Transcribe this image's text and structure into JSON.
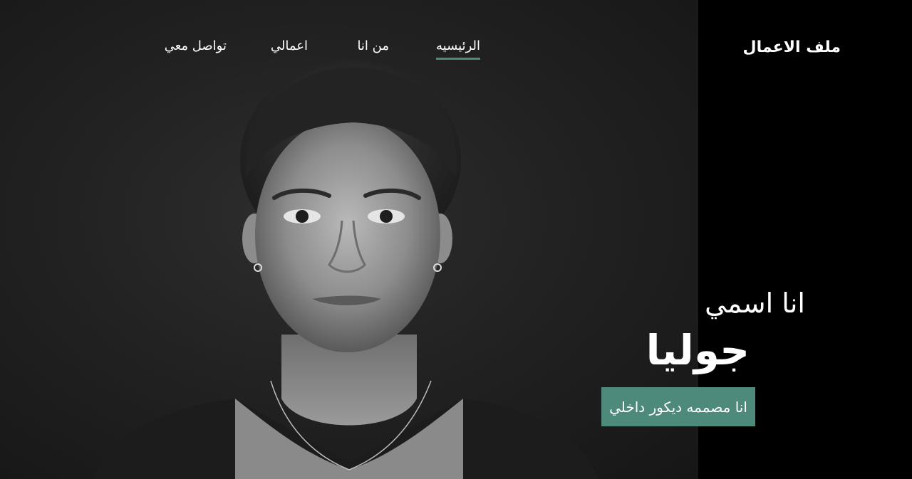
{
  "brand": {
    "title": "ملف الاعمال"
  },
  "nav": {
    "items": [
      {
        "label": "الرئيسيه",
        "active": true
      },
      {
        "label": "من انا",
        "active": false
      },
      {
        "label": "اعمالي",
        "active": false
      },
      {
        "label": "تواصل معي",
        "active": false
      }
    ]
  },
  "hero": {
    "intro": "انا اسمي",
    "name": "جوليا",
    "role": "انا مصممه ديكور داخلي"
  },
  "colors": {
    "accent": "#4e8a7c",
    "panel_bg": "#000000"
  }
}
